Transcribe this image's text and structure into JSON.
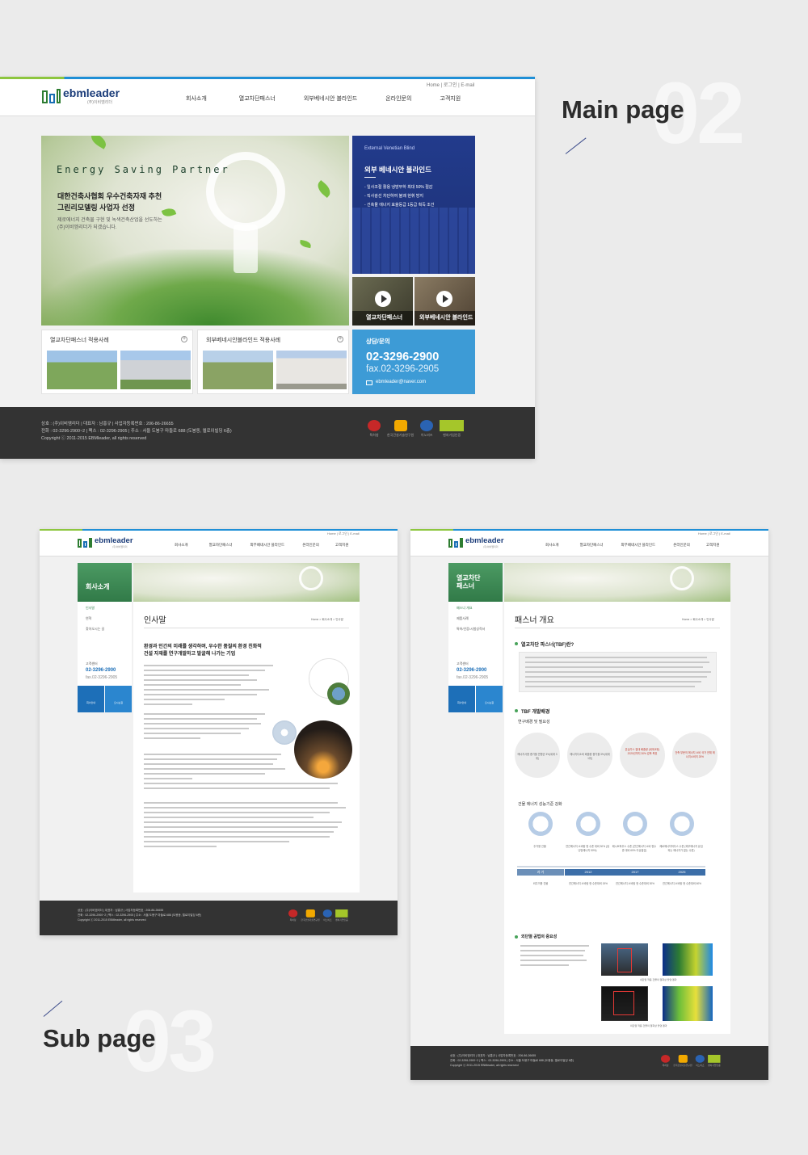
{
  "sections": {
    "main": {
      "label": "Main page",
      "number": "02"
    },
    "sub": {
      "label": "Sub page",
      "number": "03"
    }
  },
  "site": {
    "logo_text": "ebmleader",
    "logo_sub": "(주)이비엠리더",
    "utility": "Home | 로그인 | E-mail",
    "nav": [
      "회사소개",
      "열교차단패스너",
      "외부베네시안 블라인드",
      "온라인문의",
      "고객지원"
    ]
  },
  "main_page": {
    "hero_tagline": "Energy Saving Partner",
    "hero_headline_1": "대한건축사협회 우수건축자재 추천",
    "hero_headline_2": "그린리모델링 사업자 선정",
    "hero_desc_1": "제로에너지 건축물 구현 및 녹색건축산업을 선도하는",
    "hero_desc_2": "(주)이비엠리더가 되겠습니다.",
    "blind_eng": "External Venetian Blind",
    "blind_title": "외부 베네시안 블라인드",
    "blind_points": [
      "- 일사조절 활용 냉방부하 최대 50% 절감",
      "- 직사광선 차단하여 불쾌 현휘 방지",
      "- 건축물 에너지 효율등급 1등급 획득 조건"
    ],
    "video_1": "열교차단패스너",
    "video_2": "외부베네시안 블라인드",
    "card_1": "열교차단패스너 적용사례",
    "card_2": "외부베네시안블라인드 적용사례",
    "contact_label": "상담/문의",
    "contact_tel": "02-3296-2900",
    "contact_fax": "fax.02-3296-2905",
    "contact_email": "ebmleader@naver.com",
    "footer_line1": "상호 : (주)이비엠리더  |  대표자 : 남홍규  |  사업자등록번호 : 206-86-26655",
    "footer_line2": "전화 : 02-3296-2900~2  |  팩스 : 02-3296-2905  |  주소 : 서울 도봉구 마들로 688 (도봉동, 엘로이빌딩 6층)",
    "footer_line3": "Copyright ⓒ 2011-2015 EBMleader, all rights reserved",
    "certs": [
      "특허청",
      "한국건설기술연구원",
      "이노비즈",
      "벤처기업인증"
    ]
  },
  "sub_page_1": {
    "side_title": "회사소개",
    "side_items": [
      "인사말",
      "연혁",
      "찾아오시는 길"
    ],
    "side_contact_label": "고객센터",
    "side_tel": "02-3296-2900",
    "side_fax": "fax.02-3296-2905",
    "side_btn_1": "회사안내",
    "side_btn_2": "오시는길",
    "page_title": "인사말",
    "breadcrumb": "Home > 회사소개 > 인사말",
    "lead_1": "환경과 인간의 미래를 생각하며, 우수한 품질의 환경 친화적",
    "lead_2": "건설 자재를 연구개발하고 발굴해 나가는 기업"
  },
  "sub_page_2": {
    "side_title_1": "열교차단",
    "side_title_2": "패스너",
    "side_items": [
      "패스너 개요",
      "제품사례",
      "특허/인증/시험성적서"
    ],
    "side_contact_label": "고객센터",
    "side_tel": "02-3296-2900",
    "side_fax": "fax.02-3296-2905",
    "page_title": "패스너 개요",
    "breadcrumb": "Home > 회사소개 > 인사말",
    "section_1": "열교차단 파스너(TBF)란?",
    "section_2": "TBF 개발배경",
    "sub_2a": "연구배경 및 필요성",
    "bg_circles": [
      "에너지사용 증가율 연평균 3%(세계 3위)",
      "에너지다소비 배출량 증가율 3%(세계 1위)",
      "온실가스 절대 배출량 (세계 8위) 2020년까지 30% 감축 목표",
      "건축 부문의 에너지 소비 국가 전체 에너지소비의 25%"
    ],
    "sub_2b": "건물 에너지 성능기준 강화",
    "timeline_years": [
      "과 거",
      "2012",
      "2017",
      "2025"
    ],
    "timeline_top": [
      "주거용 건물",
      "연간에너지 소비량 현 수준 대비 30% (냉난방에너지 50%)",
      "패시브하우스 수준 (연간에너지 소비 현수준 대비 60% 이상절감)",
      "제로에너지하우스 수준 (외부에너지 유입되는 에너지가 없는 수준)"
    ],
    "timeline_bottom": [
      "비주거용 건물",
      "연간에너지 소비량 현 수준대비 15%",
      "연간에너지 소비량 현 수준대비 30%",
      "연간에너지 소비량 현 수준대비 60%"
    ],
    "section_3": "외단열 공법의 중요성",
    "thermal_caption_1": "내단열 적용 건물의 열화상 촬영 결과",
    "thermal_caption_2": "외단열 적용 건물의 열화상 촬영 결과"
  },
  "colors": {
    "brand_green": "#317a48",
    "brand_blue": "#1d3175",
    "accent_blue": "#3d9bd6",
    "footer": "#333333"
  }
}
